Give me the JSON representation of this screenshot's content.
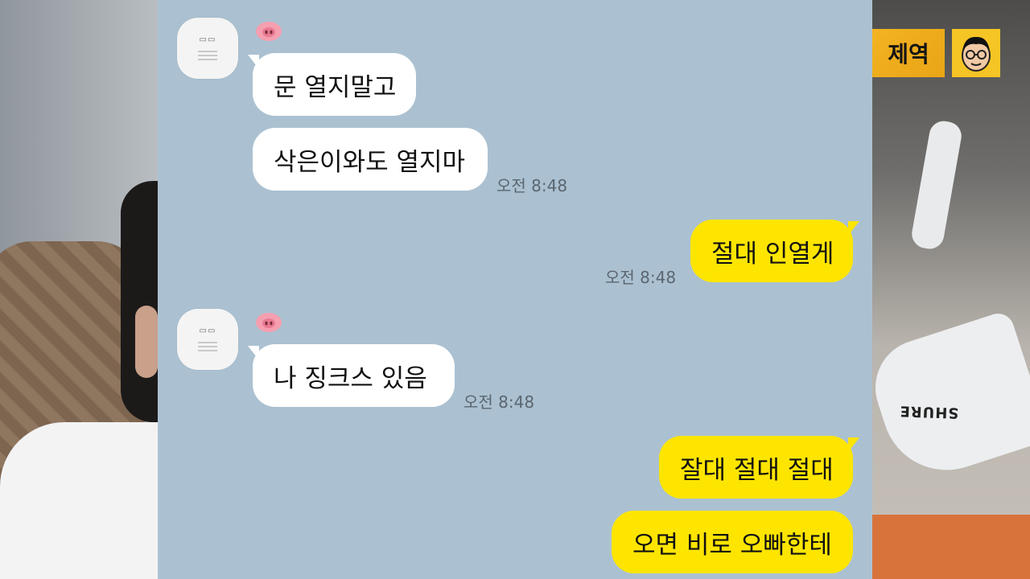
{
  "channel": {
    "logo_text": "제역",
    "avatar_icon": "cartoon-face-icon"
  },
  "background": {
    "mic_brand": "SHURE"
  },
  "chat": {
    "colors": {
      "background": "#abc1d1",
      "incoming_bubble": "#ffffff",
      "outgoing_bubble": "#fee500",
      "timestamp": "#5b6670"
    },
    "sender_avatar_icon": "profile-image-icon",
    "sender_name_icon": "pig-emoji-icon",
    "messages": [
      {
        "direction": "incoming",
        "text": "문 열지말고"
      },
      {
        "direction": "incoming",
        "text": "삭은이와도 열지마",
        "time": "오전 8:48"
      },
      {
        "direction": "outgoing",
        "text": "절대 인열게",
        "time": "오전 8:48"
      },
      {
        "direction": "incoming",
        "text": "나 징크스 있음",
        "time": "오전 8:48"
      },
      {
        "direction": "outgoing",
        "text": "잘대 절대 절대"
      },
      {
        "direction": "outgoing",
        "text": "오면 비로 오빠한테"
      }
    ]
  }
}
